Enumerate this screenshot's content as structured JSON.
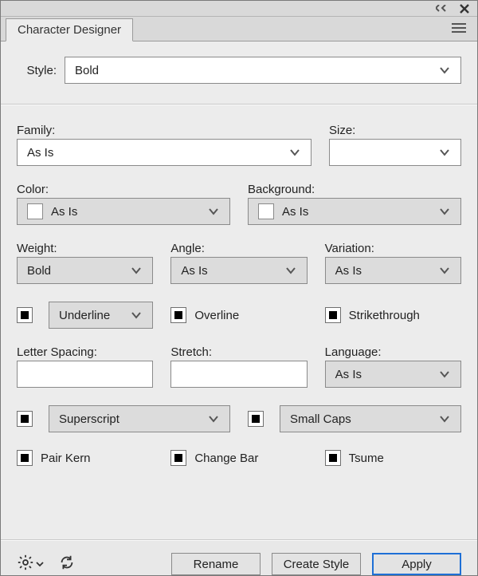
{
  "titlebar": {
    "collapse_tooltip": "Collapse",
    "close_tooltip": "Close"
  },
  "tab": {
    "label": "Character Designer"
  },
  "style": {
    "label": "Style:",
    "value": "Bold"
  },
  "family": {
    "label": "Family:",
    "value": "As Is"
  },
  "size": {
    "label": "Size:",
    "value": ""
  },
  "color": {
    "label": "Color:",
    "value": "As Is"
  },
  "background": {
    "label": "Background:",
    "value": "As Is"
  },
  "weight": {
    "label": "Weight:",
    "value": "Bold"
  },
  "angle": {
    "label": "Angle:",
    "value": "As Is"
  },
  "variation": {
    "label": "Variation:",
    "value": "As Is"
  },
  "underline": {
    "label": "Underline"
  },
  "overline": {
    "label": "Overline"
  },
  "strikethrough": {
    "label": "Strikethrough"
  },
  "letter_spacing": {
    "label": "Letter Spacing:",
    "value": ""
  },
  "stretch": {
    "label": "Stretch:",
    "value": ""
  },
  "language": {
    "label": "Language:",
    "value": "As Is"
  },
  "superscript": {
    "label": "Superscript"
  },
  "smallcaps": {
    "label": "Small Caps"
  },
  "pair_kern": {
    "label": "Pair Kern"
  },
  "change_bar": {
    "label": "Change Bar"
  },
  "tsume": {
    "label": "Tsume"
  },
  "buttons": {
    "rename": "Rename",
    "create_style": "Create Style",
    "apply": "Apply"
  }
}
